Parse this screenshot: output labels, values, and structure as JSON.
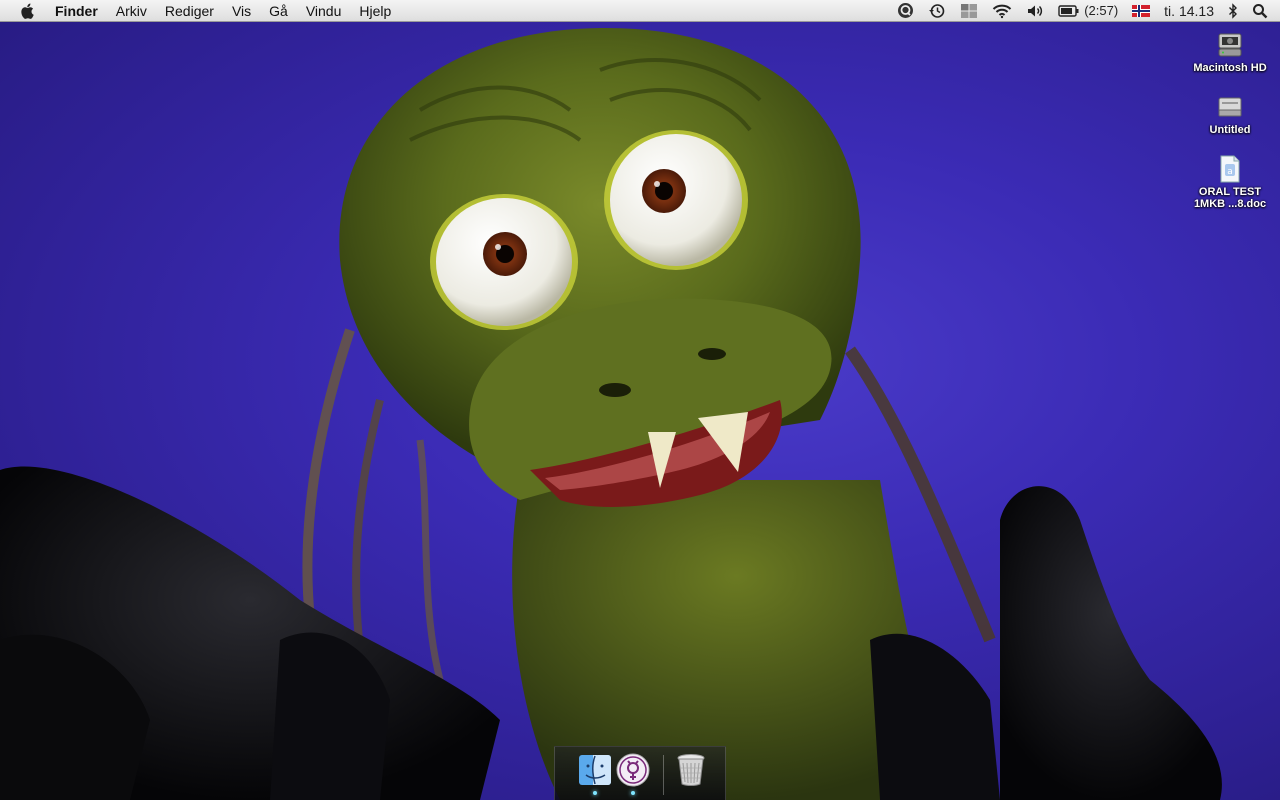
{
  "menubar": {
    "apple_icon": "apple-icon",
    "app_name": "Finder",
    "items": [
      "Arkiv",
      "Rediger",
      "Vis",
      "Gå",
      "Vindu",
      "Hjelp"
    ],
    "status": {
      "quicksilver_icon": "quicksilver-icon",
      "time_machine_icon": "time-machine-icon",
      "spaces_icon": "spaces-icon",
      "wifi_icon": "wifi-icon",
      "volume_icon": "volume-icon",
      "battery_icon": "battery-icon",
      "battery_time": "(2:57)",
      "input_flag_icon": "norwegian-flag-icon",
      "clock": "ti. 14.13",
      "bluetooth_icon": "bluetooth-icon",
      "spotlight_icon": "spotlight-icon"
    }
  },
  "desktop_icons": [
    {
      "name": "Macintosh HD",
      "icon": "hard-drive-icon"
    },
    {
      "name": "Untitled",
      "icon": "disk-icon"
    },
    {
      "name": "ORAL TEST\n1MKB ...8.doc",
      "icon": "document-icon"
    }
  ],
  "dock": {
    "items": [
      {
        "name": "Finder",
        "icon": "finder-icon",
        "running": true
      },
      {
        "name": "App",
        "icon": "gender-symbol-icon",
        "running": true
      },
      {
        "name": "Trash",
        "icon": "trash-icon",
        "running": false
      }
    ]
  },
  "colors": {
    "wallpaper_blue": "#3b2bb5",
    "creature_green": "#5a6b1c",
    "menubar": "#e8e8e8"
  }
}
